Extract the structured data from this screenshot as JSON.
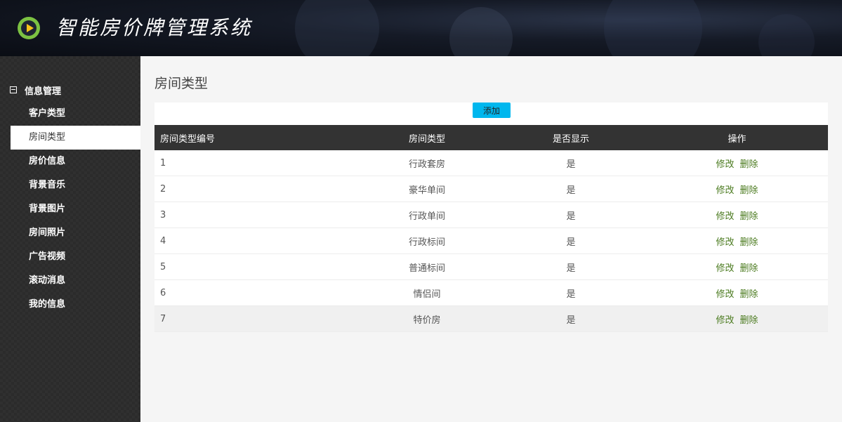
{
  "app": {
    "title": "智能房价牌管理系统"
  },
  "sidebar": {
    "group_title": "信息管理",
    "items": [
      {
        "label": "客户类型",
        "active": false
      },
      {
        "label": "房间类型",
        "active": true
      },
      {
        "label": "房价信息",
        "active": false
      },
      {
        "label": "背景音乐",
        "active": false
      },
      {
        "label": "背景图片",
        "active": false
      },
      {
        "label": "房间照片",
        "active": false
      },
      {
        "label": "广告视频",
        "active": false
      },
      {
        "label": "滚动消息",
        "active": false
      },
      {
        "label": "我的信息",
        "active": false
      }
    ]
  },
  "main": {
    "page_title": "房间类型",
    "add_label": "添加",
    "table": {
      "headers": [
        "房间类型编号",
        "房间类型",
        "是否显示",
        "操作"
      ],
      "edit_label": "修改",
      "delete_label": "删除",
      "rows": [
        {
          "id": "1",
          "type": "行政套房",
          "visible": "是"
        },
        {
          "id": "2",
          "type": "豪华单间",
          "visible": "是"
        },
        {
          "id": "3",
          "type": "行政单间",
          "visible": "是"
        },
        {
          "id": "4",
          "type": "行政标间",
          "visible": "是"
        },
        {
          "id": "5",
          "type": "普通标间",
          "visible": "是"
        },
        {
          "id": "6",
          "type": "情侣间",
          "visible": "是"
        },
        {
          "id": "7",
          "type": "特价房",
          "visible": "是"
        }
      ]
    }
  },
  "colors": {
    "accent_button": "#00b7ee",
    "table_header": "#333333",
    "link": "#4a7a1e",
    "sidebar_bg": "#2b2b2b"
  }
}
